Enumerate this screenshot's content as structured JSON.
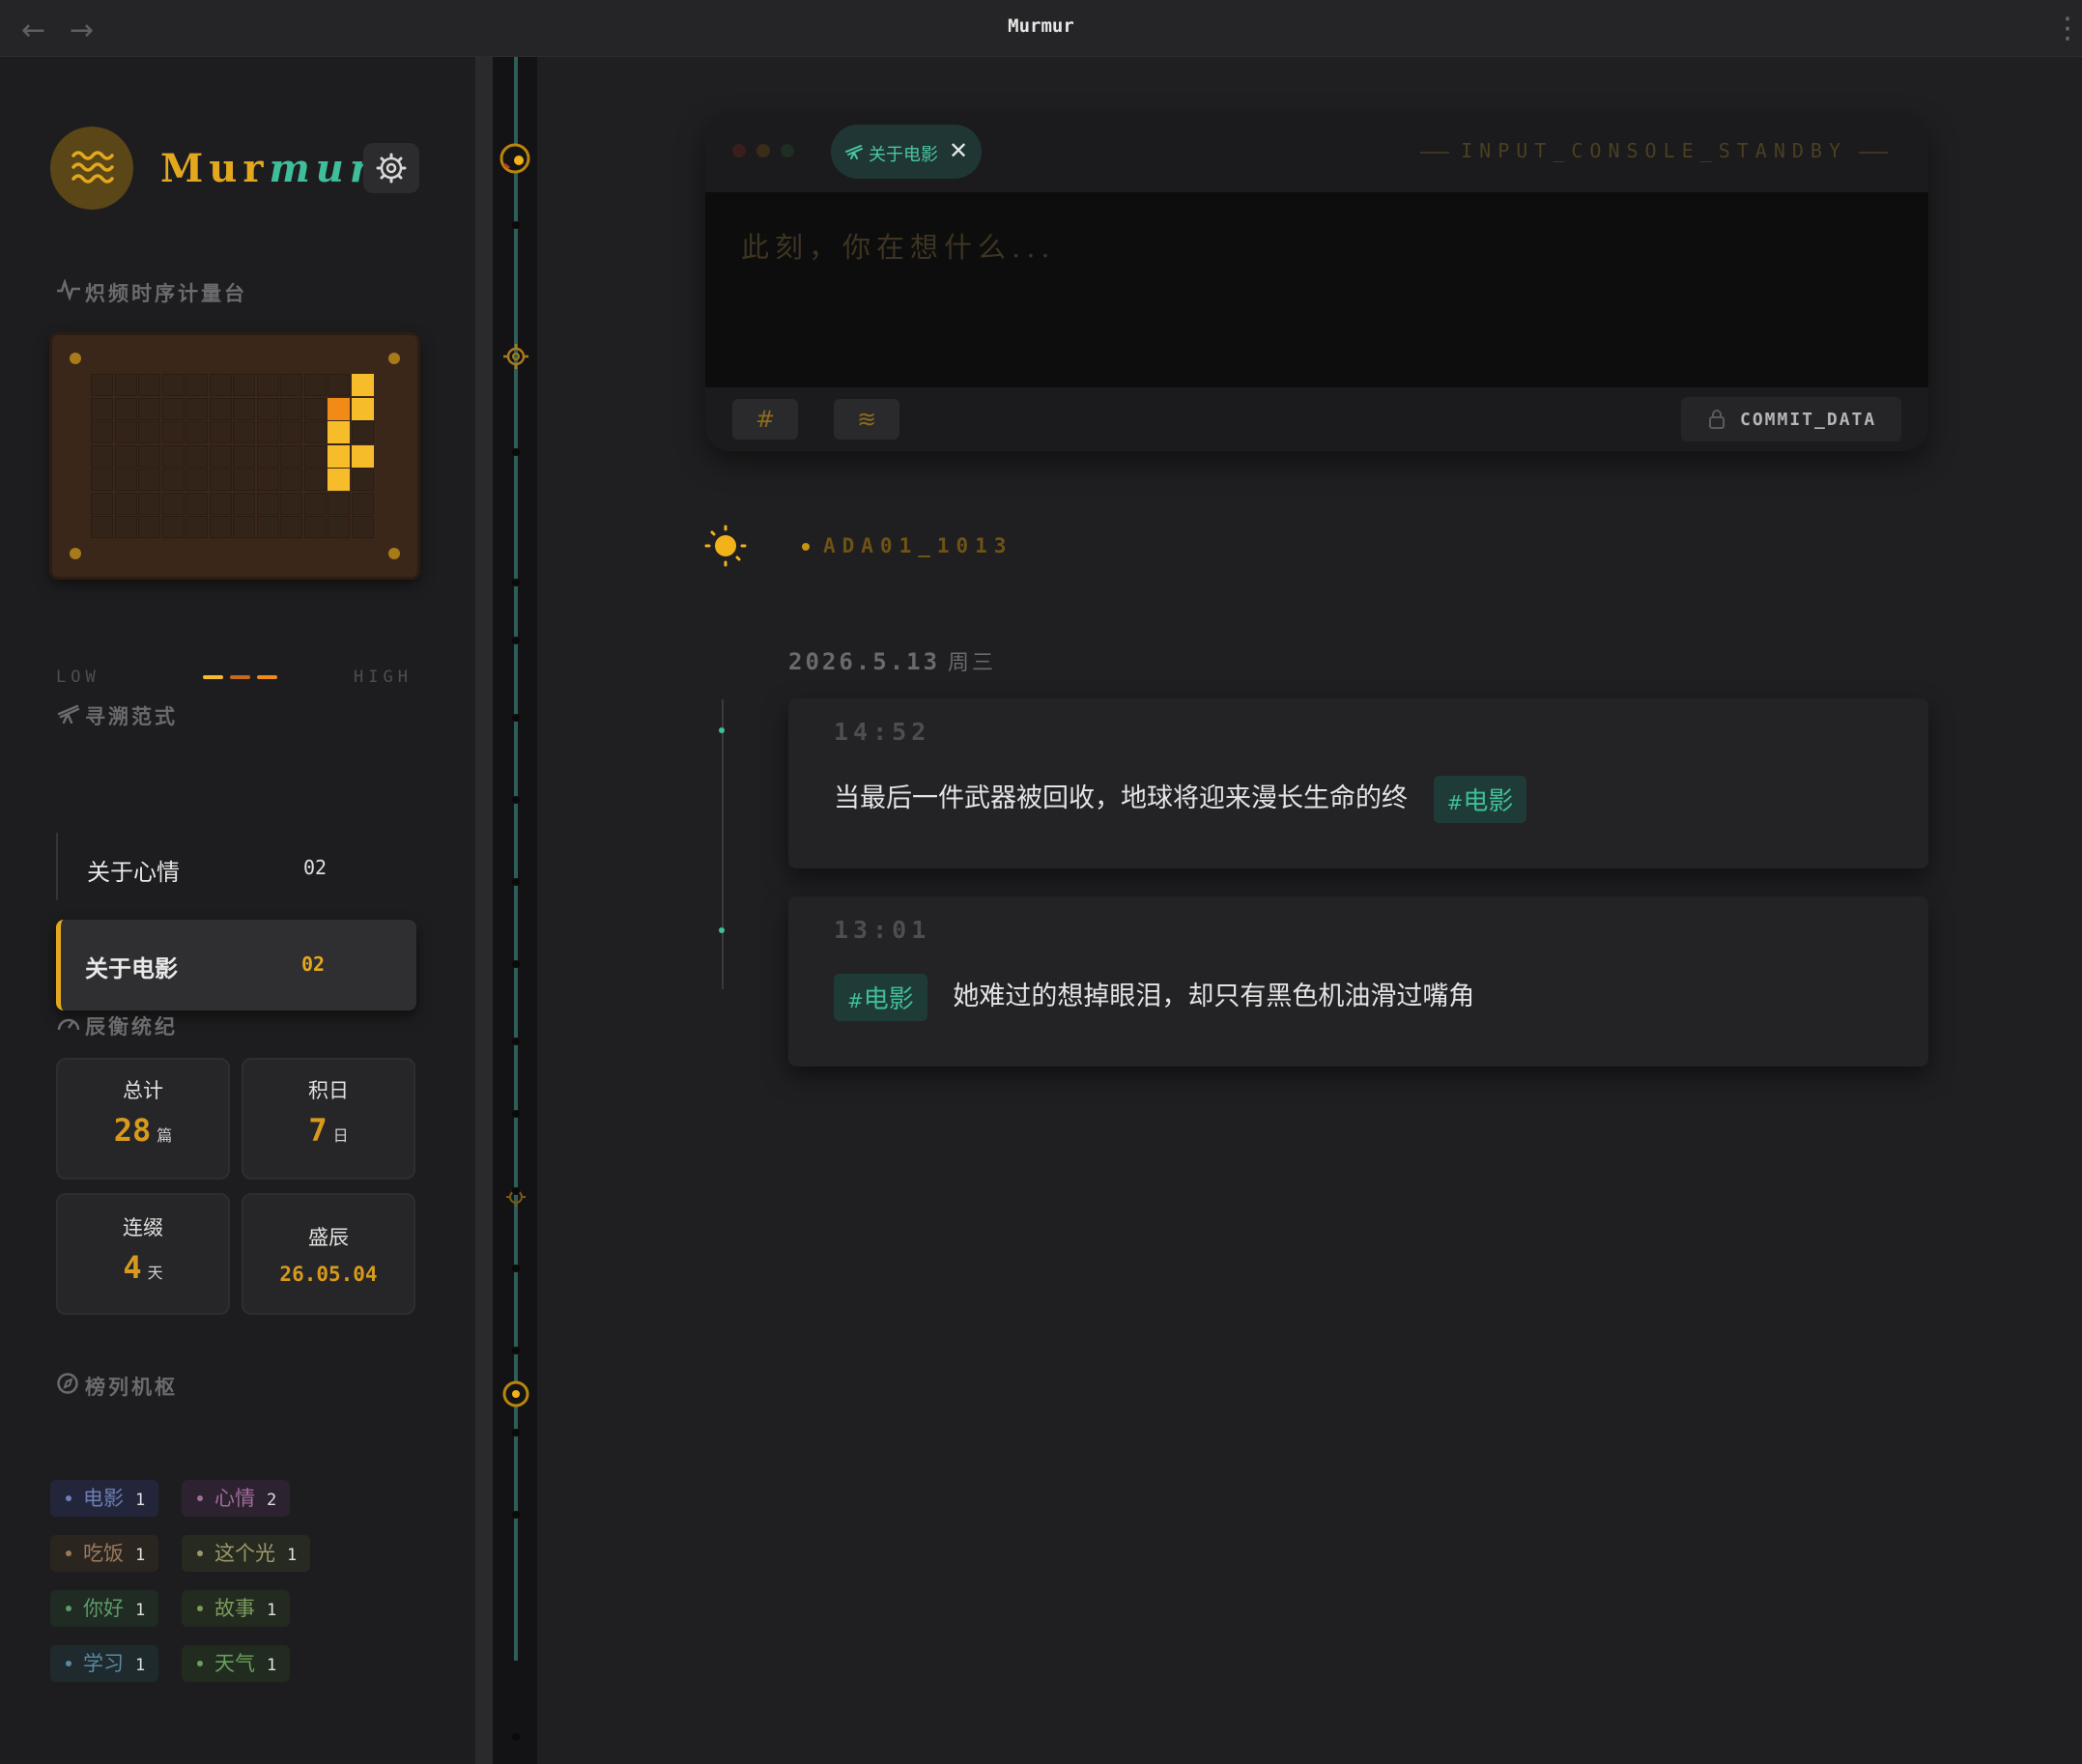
{
  "window": {
    "title": "Murmur",
    "back_icon": "←",
    "forward_icon": "→",
    "menu_icon": "⋮"
  },
  "brand": {
    "part1": "Mur",
    "part2": "mur"
  },
  "sections": {
    "heatmap_title": "炽频时序计量台",
    "collections_title": "寻溯范式",
    "stats_title": "辰衡统纪",
    "tags_title": "榜列机枢"
  },
  "heatmap": {
    "low_label": "LOW",
    "high_label": "HIGH",
    "rows": 7,
    "cols": 12,
    "active_cells": [
      {
        "col": 11,
        "row": 0,
        "level": "high"
      },
      {
        "col": 10,
        "row": 1,
        "level": "max"
      },
      {
        "col": 11,
        "row": 1,
        "level": "high"
      },
      {
        "col": 10,
        "row": 2,
        "level": "high"
      },
      {
        "col": 10,
        "row": 3,
        "level": "high"
      },
      {
        "col": 11,
        "row": 3,
        "level": "high"
      },
      {
        "col": 10,
        "row": 4,
        "level": "high"
      }
    ],
    "colors": {
      "high": "#f6bc2a",
      "max": "#f28b16",
      "mid": "#c7691a"
    }
  },
  "collections": [
    {
      "label": "关于心情",
      "count": "02",
      "active": false
    },
    {
      "label": "关于电影",
      "count": "02",
      "active": true
    }
  ],
  "stats": {
    "total_label": "总计",
    "total_value": "28",
    "total_unit": "篇",
    "days_label": "积日",
    "days_value": "7",
    "days_unit": "日",
    "streak_label": "连缀",
    "streak_value": "4",
    "streak_unit": "天",
    "peak_label": "盛辰",
    "peak_value": "26.05.04"
  },
  "tags": [
    {
      "name": "电影",
      "count": "1",
      "color": "#6d7fb5",
      "bg": "#23263a"
    },
    {
      "name": "心情",
      "count": "2",
      "color": "#a06c9a",
      "bg": "#2c2230"
    },
    {
      "name": "吃饭",
      "count": "1",
      "color": "#9a7a5a",
      "bg": "#2b2520"
    },
    {
      "name": "这个光",
      "count": "1",
      "color": "#9a9a6a",
      "bg": "#272a20"
    },
    {
      "name": "你好",
      "count": "1",
      "color": "#5c9a6a",
      "bg": "#202b24"
    },
    {
      "name": "故事",
      "count": "1",
      "color": "#7a9a5c",
      "bg": "#232a20"
    },
    {
      "name": "学习",
      "count": "1",
      "color": "#5a8aa0",
      "bg": "#1f2a2e"
    },
    {
      "name": "天气",
      "count": "1",
      "color": "#6aa05a",
      "bg": "#212b20"
    }
  ],
  "console": {
    "filter_chip": "关于电影",
    "filter_icon": "telescope-icon",
    "status": "INPUT_CONSOLE_STANDBY",
    "placeholder": "此刻，你在想什么...",
    "hash_button": "#",
    "wave_button": "≋",
    "commit_label": "COMMIT_DATA"
  },
  "user": {
    "id": "ADA01_1013"
  },
  "feed": {
    "date": "2026.5.13",
    "weekday": "周三",
    "entries": [
      {
        "time": "14:52",
        "text": "当最后一件武器被回收，地球将迎来漫长生命的终",
        "tag": "电影",
        "tag_position": "end"
      },
      {
        "time": "13:01",
        "text": "她难过的想掉眼泪，却只有黑色机油滑过嘴角",
        "tag": "电影",
        "tag_position": "start"
      }
    ]
  },
  "accent": {
    "gold": "#e3a81e",
    "teal": "#3fbe9c"
  }
}
